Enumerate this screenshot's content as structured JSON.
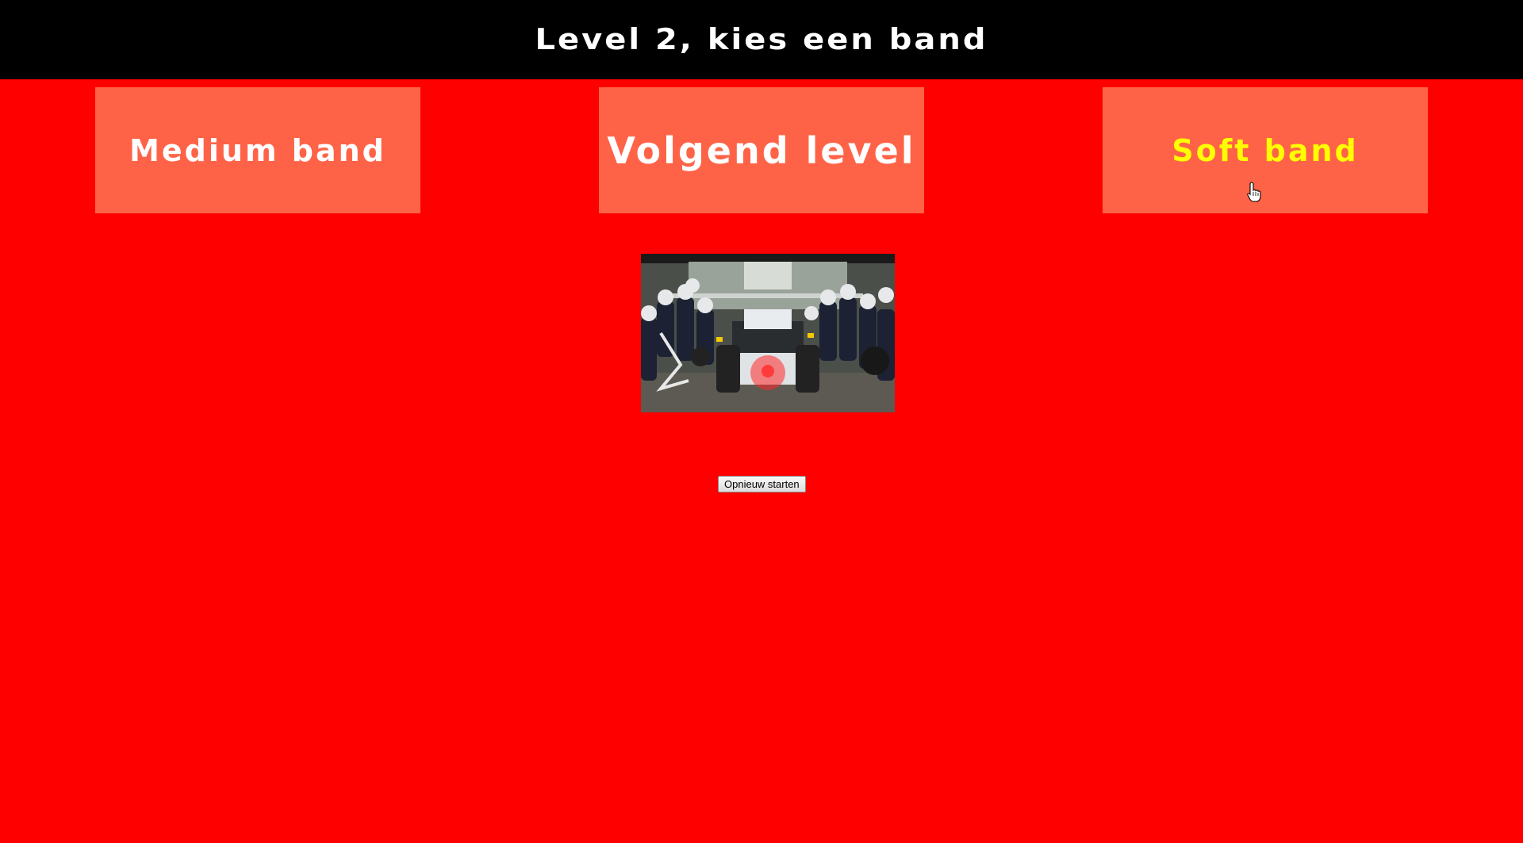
{
  "header": {
    "title": "Level 2, kies een band"
  },
  "tiles": {
    "medium_label": "Medium band",
    "next_label": "Volgend level",
    "soft_label": "Soft band"
  },
  "colors": {
    "page_background": "#ff0000",
    "header_background": "#000000",
    "tile_background": "#ff6347",
    "tile_text": "#ffffff",
    "tile_highlight_text": "#ffff00"
  },
  "image": {
    "subject": "pit-stop-photo"
  },
  "restart": {
    "label": "Opnieuw starten"
  },
  "cursor": {
    "icon": "hand-pointer-icon"
  }
}
